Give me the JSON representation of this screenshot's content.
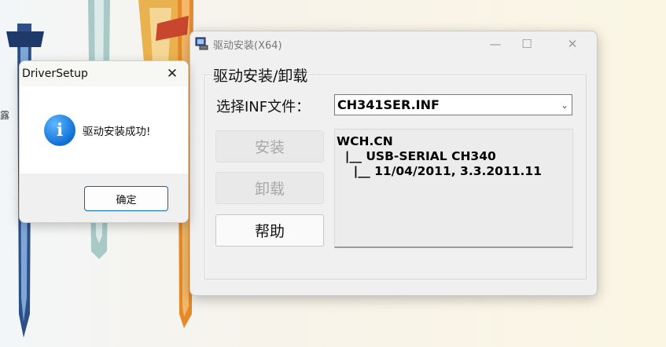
{
  "main_window": {
    "title": "驱动安装(X64)",
    "group_title": "驱动安装/卸载",
    "inf_label": "选择INF文件：",
    "inf_selected": "CH341SER.INF",
    "buttons": {
      "install": "安装",
      "uninstall": "卸载",
      "help": "帮助"
    },
    "info_lines": [
      "WCH.CN",
      "  |__ USB-SERIAL CH340",
      "    |__ 11/04/2011, 3.3.2011.11"
    ],
    "controls": {
      "minimize": "—",
      "maximize": "☐",
      "close": "✕"
    }
  },
  "message_box": {
    "title": "DriverSetup",
    "close": "✕",
    "icon": "info-icon",
    "icon_glyph": "i",
    "message": "驱动安装成功!",
    "ok_label": "确定"
  },
  "desktop": {
    "edge_char": "露"
  },
  "colors": {
    "accent": "#0a64c8",
    "window_bg": "#f0f0f0",
    "info_icon": "#0f6fd6"
  }
}
